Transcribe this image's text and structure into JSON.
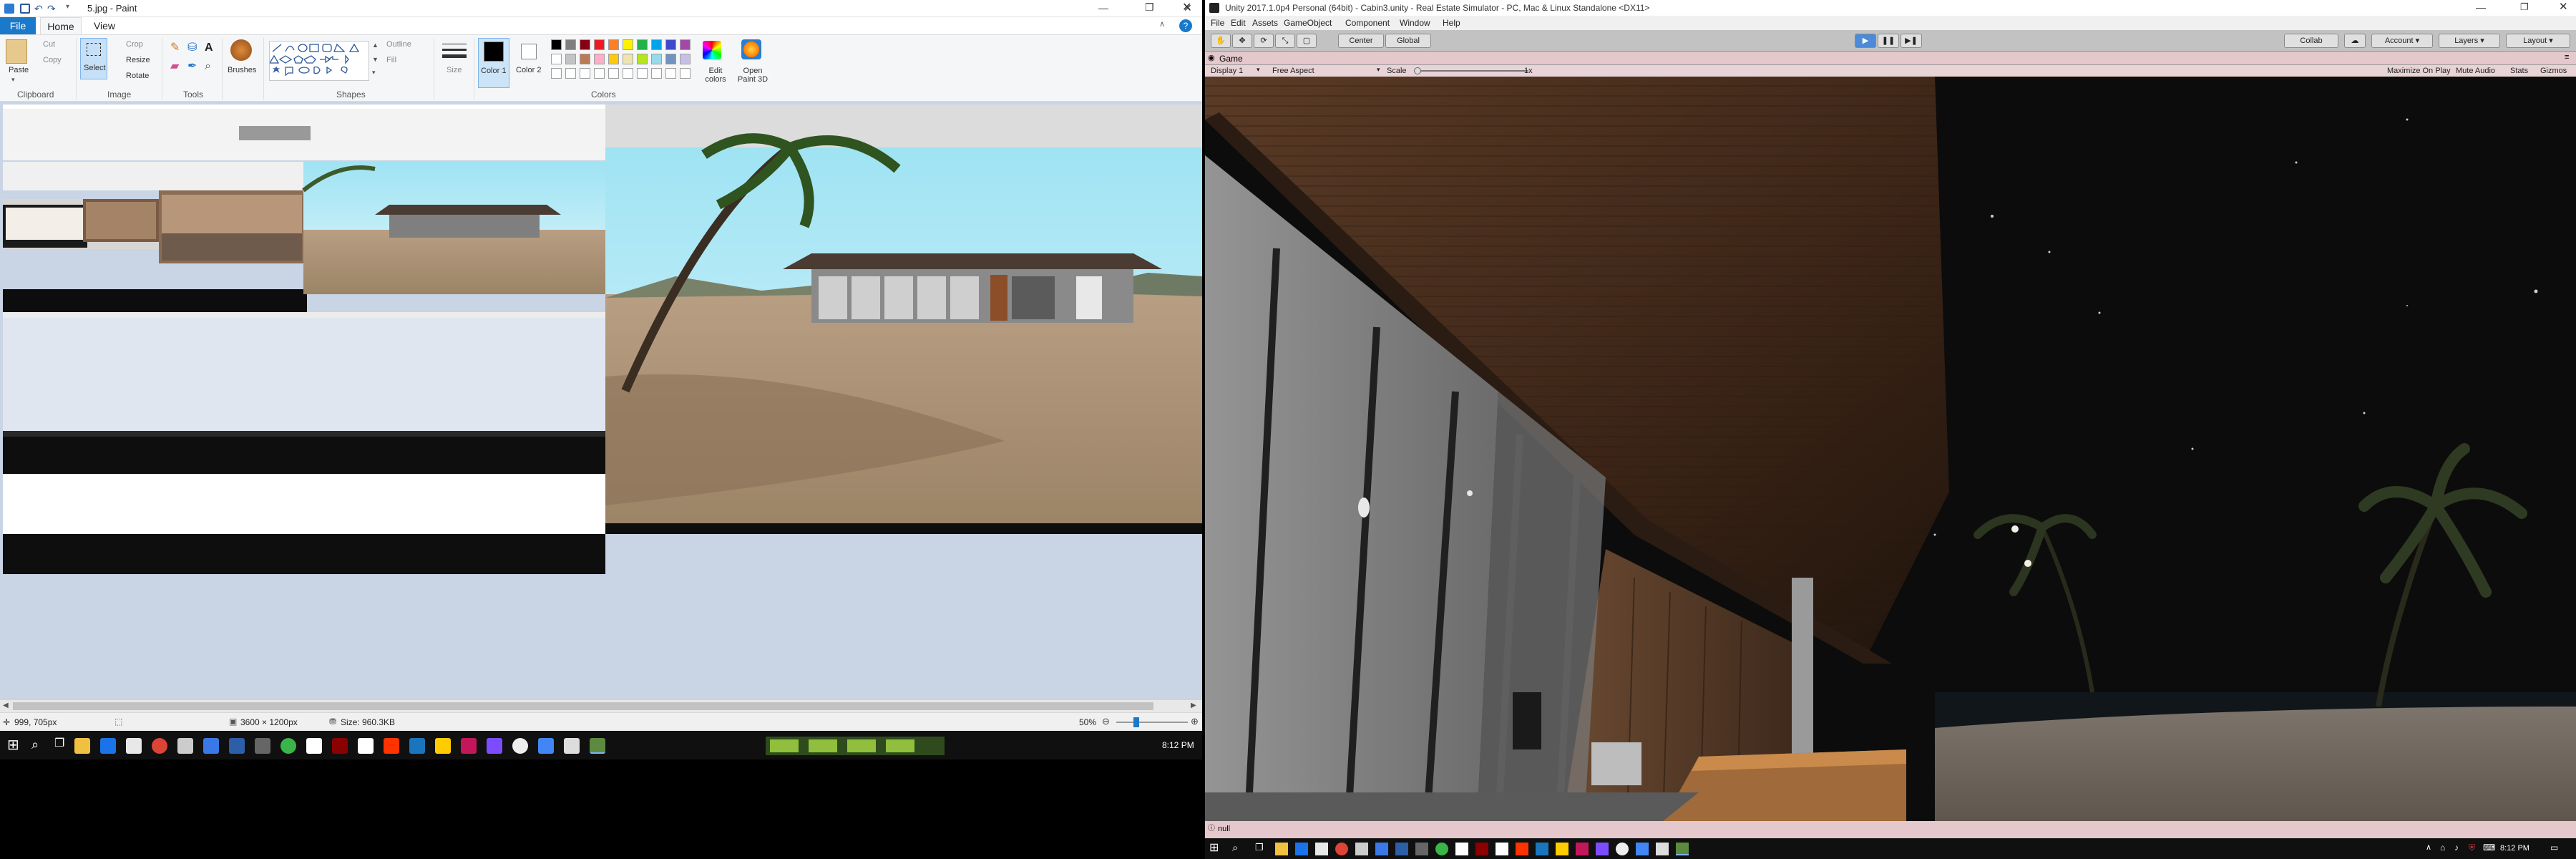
{
  "paint": {
    "title": "5.jpg - Paint",
    "tabs": {
      "file": "File",
      "home": "Home",
      "view": "View"
    },
    "ribbon": {
      "paste": "Paste",
      "cut": "Cut",
      "copy": "Copy",
      "select": "Select",
      "crop": "Crop",
      "resize": "Resize",
      "rotate": "Rotate",
      "brushes": "Brushes",
      "outline": "Outline",
      "fill": "Fill",
      "size": "Size",
      "color1": "Color 1",
      "color2": "Color 2",
      "edit_colors": "Edit colors",
      "open_paint3d": "Open Paint 3D",
      "groups": {
        "clipboard": "Clipboard",
        "image": "Image",
        "tools": "Tools",
        "shapes": "Shapes",
        "colors": "Colors"
      },
      "palette": [
        "#000000",
        "#7f7f7f",
        "#880015",
        "#ed1c24",
        "#ff7f27",
        "#fff200",
        "#22b14c",
        "#00a2e8",
        "#3f48cc",
        "#a349a4",
        "#ffffff",
        "#c3c3c3",
        "#b97a57",
        "#ffaec9",
        "#ffc90e",
        "#efe4b0",
        "#b5e61d",
        "#99d9ea",
        "#7092be",
        "#c8bfe7"
      ]
    },
    "status": {
      "cursor": "999, 705px",
      "dimensions": "3600 × 1200px",
      "size": "Size: 960.3KB",
      "zoom": "50%"
    }
  },
  "taskbar_left": {
    "time": "8:12 PM"
  },
  "unity": {
    "title": "Unity 2017.1.0p4 Personal (64bit) - Cabin3.unity - Real Estate Simulator - PC, Mac & Linux Standalone <DX11>",
    "menu": [
      "File",
      "Edit",
      "Assets",
      "GameObject",
      "Component",
      "Window",
      "Help"
    ],
    "toolbar": {
      "center": "Center",
      "global": "Global",
      "collab": "Collab",
      "account": "Account",
      "layers": "Layers",
      "layout": "Layout"
    },
    "game_tab": "Game",
    "game_bar": {
      "display": "Display 1",
      "aspect": "Free Aspect",
      "scale_label": "Scale",
      "scale_value": "1x",
      "maximize": "Maximize On Play",
      "mute": "Mute Audio",
      "stats": "Stats",
      "gizmos": "Gizmos"
    },
    "status_text": "null"
  },
  "taskbar_right": {
    "time": "8:12 PM"
  }
}
